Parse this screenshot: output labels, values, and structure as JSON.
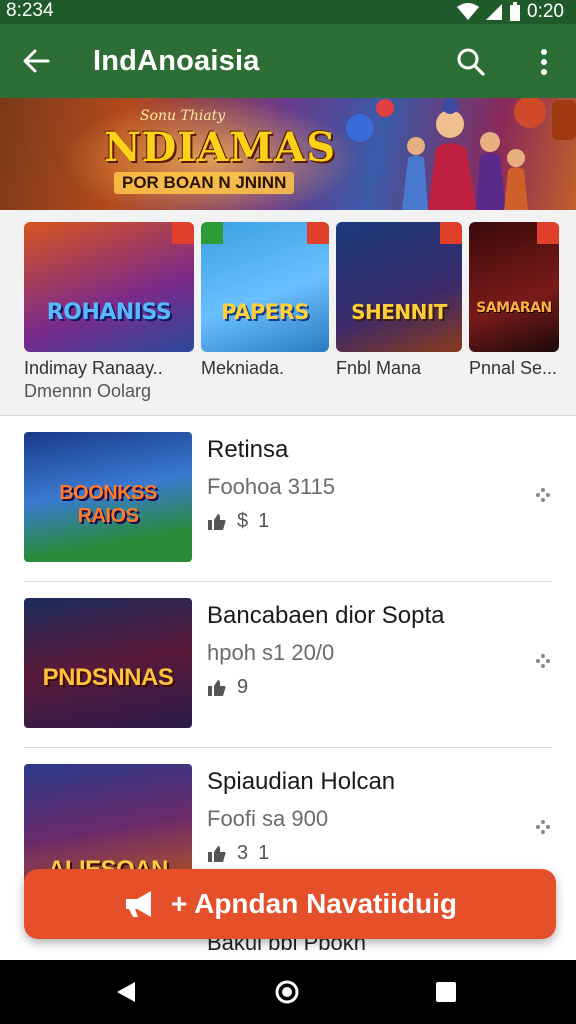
{
  "status_bar": {
    "time": "8:234",
    "battery_text": "0:20"
  },
  "app_bar": {
    "title": "IndAnoaisia"
  },
  "banner": {
    "tagline": "Sonu Thiaty",
    "heading": "NDIAMAS",
    "subtitle": "POR BOAN N JNINN"
  },
  "featured": [
    {
      "name": "Indimay Ranaay..",
      "subtitle": "Dmennn Oolarg",
      "logo": "ROHANISS",
      "logo_color": "#5ab8ff"
    },
    {
      "name": "Mekniada.",
      "subtitle": "",
      "logo": "PAPERS",
      "logo_color": "#ffd23a"
    },
    {
      "name": "Fnbl Mana",
      "subtitle": "",
      "logo": "SHENNIT",
      "logo_color": "#ffcf3a"
    },
    {
      "name": "Pnnal Se...",
      "subtitle": "",
      "logo": "SAMARAN",
      "logo_color": "#ffb040"
    }
  ],
  "list": [
    {
      "title": "Retinsa",
      "meta": "Foohoa 3115",
      "stat_a": "$",
      "stat_b": "1",
      "logo": "BOONKSS RAIOS",
      "logo_color": "#ff7a2a"
    },
    {
      "title": "Bancabaen dior Sopta",
      "meta": "hpoh s1 20/0",
      "stat_a": "9",
      "stat_b": "",
      "logo": "PNDSNNAS",
      "logo_color": "#ffc23a"
    },
    {
      "title": "Spiaudian Holcan",
      "meta": "Foofi sa 900",
      "stat_a": "3",
      "stat_b": "1",
      "logo": "ALIESOAN",
      "logo_color": "#ffd040"
    }
  ],
  "partial_item_title": "Bakui bbi Pbokn",
  "fab": {
    "label": "+ Apndan Navatiiduig"
  },
  "colors": {
    "app_bar": "#2c6e35",
    "status_bar": "#1f5a2a",
    "fab": "#e5502a"
  }
}
